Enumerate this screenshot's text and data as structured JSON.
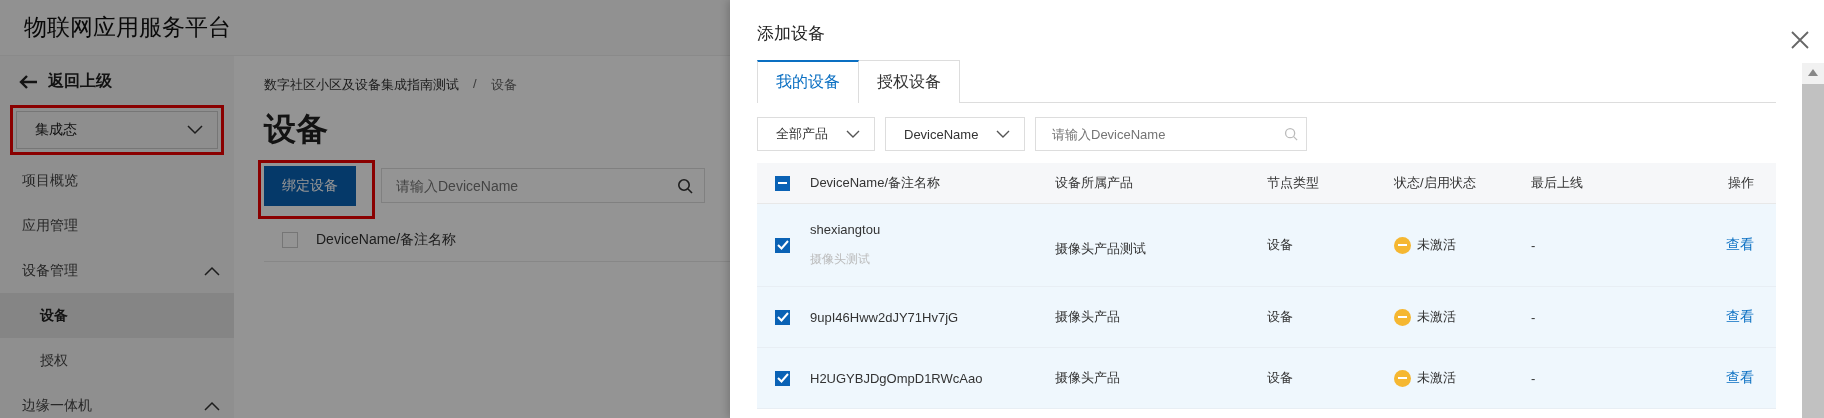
{
  "header": {
    "title": "物联网应用服务平台"
  },
  "sidebar": {
    "back": "返回上级",
    "state_select": {
      "value": "集成态",
      "highlighted": true
    },
    "menu": [
      {
        "label": "项目概览",
        "selected": false
      },
      {
        "label": "应用管理",
        "selected": false
      },
      {
        "label": "设备管理",
        "expanded": true,
        "children": [
          {
            "label": "设备",
            "selected": true
          },
          {
            "label": "授权",
            "selected": false
          }
        ]
      },
      {
        "label": "边缘一体机",
        "expanded": true
      }
    ]
  },
  "main": {
    "breadcrumb": {
      "items": [
        "数字社区小区及设备集成指南测试",
        "设备"
      ],
      "separator": "/"
    },
    "title": "设备",
    "bind_button": {
      "label": "绑定设备",
      "highlighted": true
    },
    "search": {
      "placeholder": "请输入DeviceName"
    },
    "table": {
      "columns": [
        "DeviceName/备注名称"
      ],
      "header_checkbox": {
        "checked": false
      }
    }
  },
  "drawer": {
    "title": "添加设备",
    "tabs": [
      {
        "label": "我的设备",
        "selected": true
      },
      {
        "label": "授权设备",
        "selected": false
      }
    ],
    "filters": {
      "product": "全部产品",
      "field": "DeviceName",
      "search_placeholder": "请输入DeviceName"
    },
    "table": {
      "header_checkbox": {
        "indeterminate": true
      },
      "columns": [
        "DeviceName/备注名称",
        "设备所属产品",
        "节点类型",
        "状态/启用状态",
        "最后上线",
        "操作"
      ],
      "rows": [
        {
          "name": "shexiangtou",
          "note": "摄像头测试",
          "product": "摄像头产品测试",
          "node_type": "设备",
          "status": "未激活",
          "color": "#f5b731",
          "last_online": "-",
          "action": "查看",
          "checked": true
        },
        {
          "name": "9upI46Hww2dJY71Hv7jG",
          "product": "摄像头产品",
          "node_type": "设备",
          "status": "未激活",
          "color": "#f5b731",
          "last_online": "-",
          "action": "查看",
          "checked": true
        },
        {
          "name": "H2UGYBJDgOmpD1RWcAao",
          "product": "摄像头产品",
          "node_type": "设备",
          "status": "未激活",
          "color": "#f5b731",
          "last_online": "-",
          "action": "查看",
          "checked": true
        }
      ]
    }
  }
}
